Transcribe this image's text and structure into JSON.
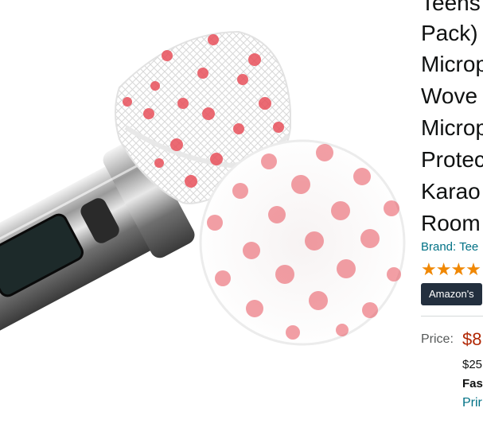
{
  "product": {
    "title_lines": [
      "Teens",
      "Pack)",
      "Microp",
      "Wove",
      "Microp",
      "Protec",
      "Karao",
      "Room"
    ],
    "brand": "Brand: Tee",
    "rating_stars": "★★★★",
    "badge": "Amazon's",
    "price_label": "Price:",
    "price": "$8",
    "unit_price": "$25",
    "shipping": "Fas",
    "prime": "Prir"
  },
  "colors": {
    "link": "#007185",
    "price": "#b12704",
    "star": "#f08804",
    "badge_bg": "#232f3e",
    "polka_dot": "#e8505b"
  },
  "image": {
    "subject": "handheld microphone with disposable polka-dot mesh cover and loose cover"
  }
}
